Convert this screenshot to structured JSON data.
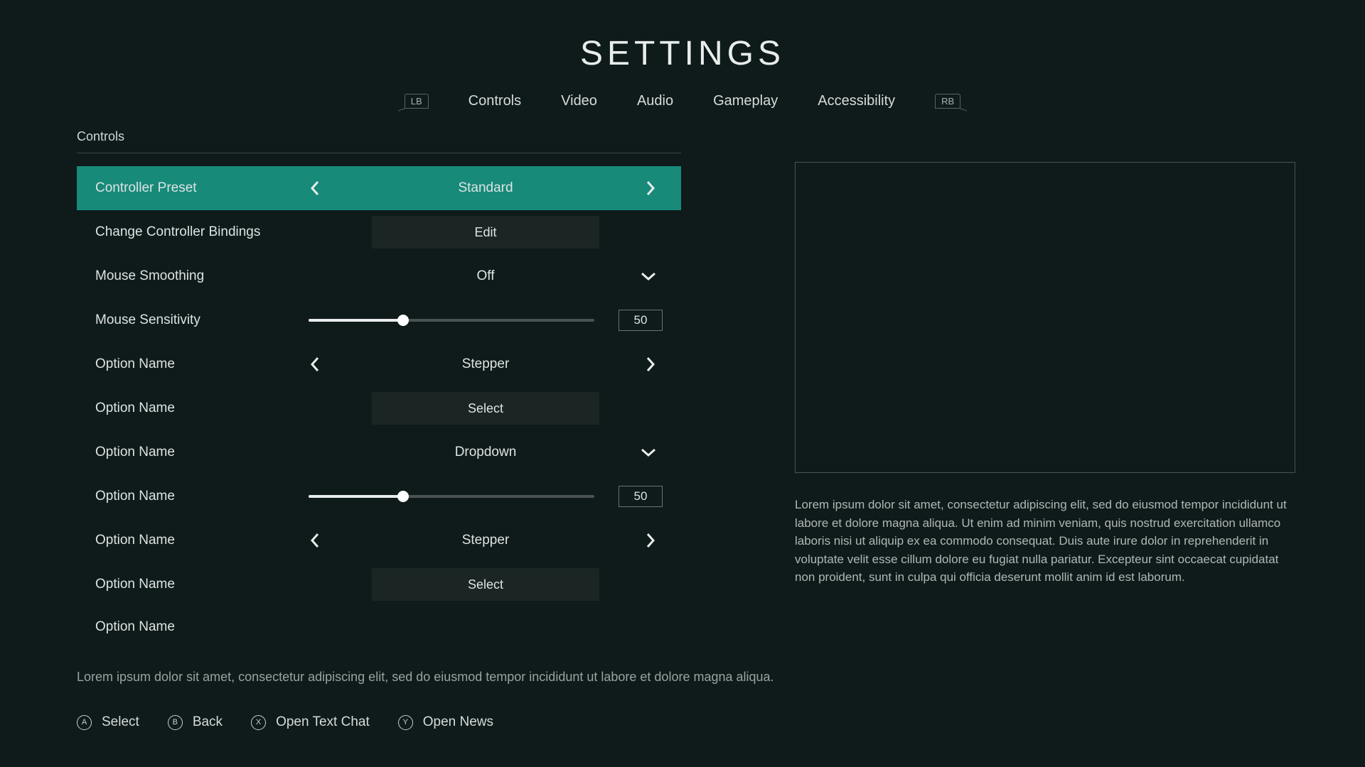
{
  "title": "SETTINGS",
  "tabs": {
    "lb": "LB",
    "rb": "RB",
    "items": [
      "Controls",
      "Video",
      "Audio",
      "Gameplay",
      "Accessibility"
    ]
  },
  "section_label": "Controls",
  "options": [
    {
      "label": "Controller Preset",
      "type": "stepper",
      "value": "Standard",
      "selected": true
    },
    {
      "label": "Change Controller Bindings",
      "type": "select",
      "value": "Edit"
    },
    {
      "label": "Mouse Smoothing",
      "type": "dropdown",
      "value": "Off"
    },
    {
      "label": "Mouse Sensitivity",
      "type": "slider",
      "value": "50",
      "percent": 33
    },
    {
      "label": "Option Name",
      "type": "stepper",
      "value": "Stepper"
    },
    {
      "label": "Option Name",
      "type": "select",
      "value": "Select"
    },
    {
      "label": "Option Name",
      "type": "dropdown",
      "value": "Dropdown"
    },
    {
      "label": "Option Name",
      "type": "slider",
      "value": "50",
      "percent": 33
    },
    {
      "label": "Option Name",
      "type": "stepper",
      "value": "Stepper"
    },
    {
      "label": "Option Name",
      "type": "select",
      "value": "Select"
    },
    {
      "label": "Option Name",
      "type": "partial"
    }
  ],
  "description": "Lorem ipsum dolor sit amet, consectetur adipiscing elit, sed do eiusmod tempor incididunt ut labore et dolore magna aliqua. Ut enim ad minim veniam, quis nostrud exercitation ullamco laboris nisi ut aliquip ex ea commodo consequat. Duis aute irure dolor in reprehenderit in voluptate velit esse cillum dolore eu fugiat nulla pariatur. Excepteur sint occaecat cupidatat non proident, sunt in culpa qui officia deserunt mollit anim id est laborum.",
  "hint": "Lorem ipsum dolor sit amet, consectetur adipiscing elit, sed do eiusmod tempor incididunt ut labore et dolore magna aliqua.",
  "prompts": [
    {
      "button": "A",
      "label": "Select"
    },
    {
      "button": "B",
      "label": "Back"
    },
    {
      "button": "X",
      "label": "Open Text Chat"
    },
    {
      "button": "Y",
      "label": "Open News"
    }
  ]
}
